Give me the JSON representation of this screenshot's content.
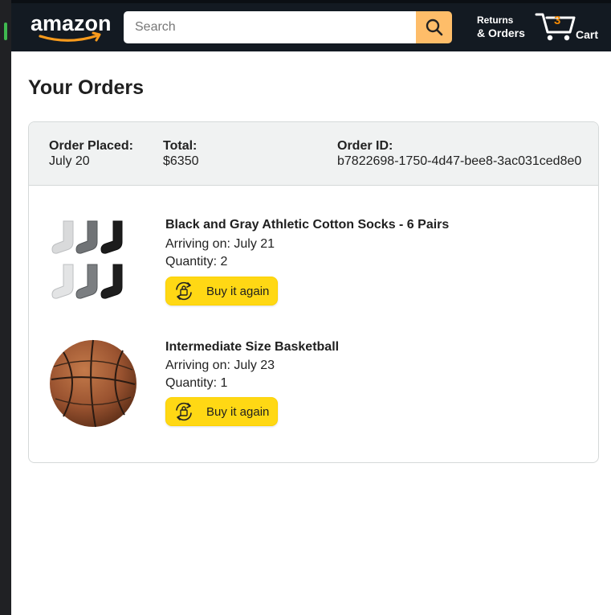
{
  "header": {
    "logo_text": "amazon",
    "search": {
      "placeholder": "Search",
      "value": ""
    },
    "returns_line1": "Returns",
    "returns_line2": "& Orders",
    "cart_count": "3",
    "cart_label": "Cart"
  },
  "page_title": "Your Orders",
  "order": {
    "placed_label": "Order Placed:",
    "placed_value": "July 20",
    "total_label": "Total:",
    "total_value": "$6350",
    "id_label": "Order ID:",
    "id_value": "b7822698-1750-4d47-bee8-3ac031ced8e0",
    "items": [
      {
        "name": "Black and Gray Athletic Cotton Socks - 6 Pairs",
        "arriving": "Arriving on: July 21",
        "quantity": "Quantity: 2",
        "buy_again": "Buy it again",
        "image": "socks-image"
      },
      {
        "name": "Intermediate Size Basketball",
        "arriving": "Arriving on: July 23",
        "quantity": "Quantity: 1",
        "buy_again": "Buy it again",
        "image": "basketball-image"
      }
    ]
  },
  "colors": {
    "topbar": "#131a22",
    "search_button": "#febd69",
    "buy_button": "#ffd814",
    "cart_count": "#f08804"
  }
}
